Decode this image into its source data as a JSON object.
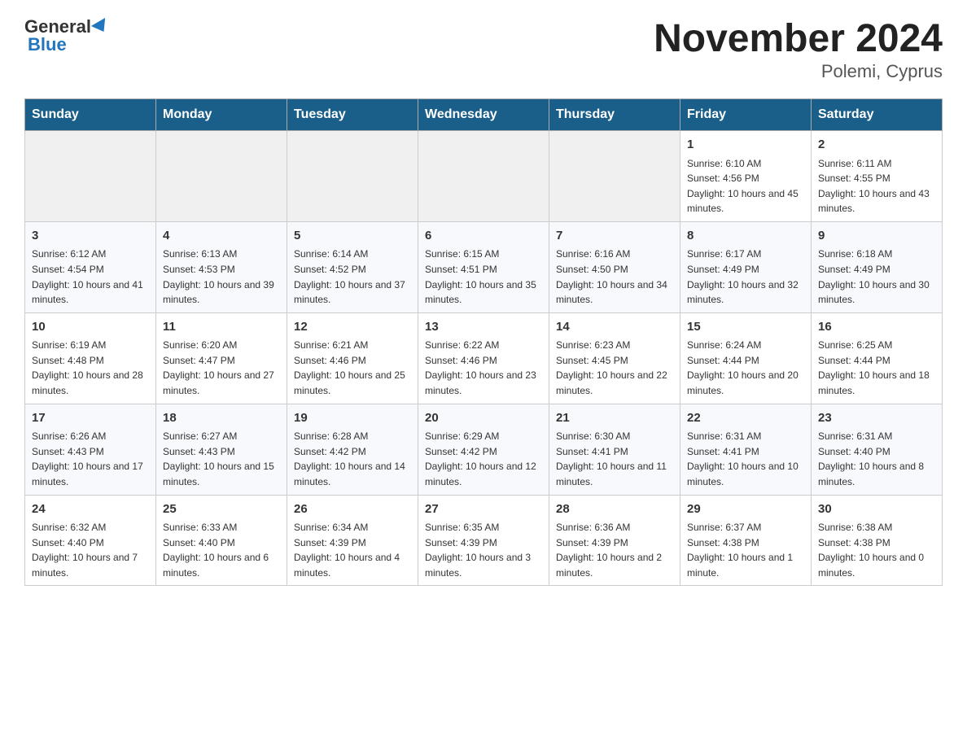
{
  "header": {
    "logo_general": "General",
    "logo_blue": "Blue",
    "title": "November 2024",
    "subtitle": "Polemi, Cyprus"
  },
  "weekdays": [
    "Sunday",
    "Monday",
    "Tuesday",
    "Wednesday",
    "Thursday",
    "Friday",
    "Saturday"
  ],
  "rows": [
    {
      "cells": [
        {
          "day": "",
          "info": ""
        },
        {
          "day": "",
          "info": ""
        },
        {
          "day": "",
          "info": ""
        },
        {
          "day": "",
          "info": ""
        },
        {
          "day": "",
          "info": ""
        },
        {
          "day": "1",
          "info": "Sunrise: 6:10 AM\nSunset: 4:56 PM\nDaylight: 10 hours and 45 minutes."
        },
        {
          "day": "2",
          "info": "Sunrise: 6:11 AM\nSunset: 4:55 PM\nDaylight: 10 hours and 43 minutes."
        }
      ]
    },
    {
      "cells": [
        {
          "day": "3",
          "info": "Sunrise: 6:12 AM\nSunset: 4:54 PM\nDaylight: 10 hours and 41 minutes."
        },
        {
          "day": "4",
          "info": "Sunrise: 6:13 AM\nSunset: 4:53 PM\nDaylight: 10 hours and 39 minutes."
        },
        {
          "day": "5",
          "info": "Sunrise: 6:14 AM\nSunset: 4:52 PM\nDaylight: 10 hours and 37 minutes."
        },
        {
          "day": "6",
          "info": "Sunrise: 6:15 AM\nSunset: 4:51 PM\nDaylight: 10 hours and 35 minutes."
        },
        {
          "day": "7",
          "info": "Sunrise: 6:16 AM\nSunset: 4:50 PM\nDaylight: 10 hours and 34 minutes."
        },
        {
          "day": "8",
          "info": "Sunrise: 6:17 AM\nSunset: 4:49 PM\nDaylight: 10 hours and 32 minutes."
        },
        {
          "day": "9",
          "info": "Sunrise: 6:18 AM\nSunset: 4:49 PM\nDaylight: 10 hours and 30 minutes."
        }
      ]
    },
    {
      "cells": [
        {
          "day": "10",
          "info": "Sunrise: 6:19 AM\nSunset: 4:48 PM\nDaylight: 10 hours and 28 minutes."
        },
        {
          "day": "11",
          "info": "Sunrise: 6:20 AM\nSunset: 4:47 PM\nDaylight: 10 hours and 27 minutes."
        },
        {
          "day": "12",
          "info": "Sunrise: 6:21 AM\nSunset: 4:46 PM\nDaylight: 10 hours and 25 minutes."
        },
        {
          "day": "13",
          "info": "Sunrise: 6:22 AM\nSunset: 4:46 PM\nDaylight: 10 hours and 23 minutes."
        },
        {
          "day": "14",
          "info": "Sunrise: 6:23 AM\nSunset: 4:45 PM\nDaylight: 10 hours and 22 minutes."
        },
        {
          "day": "15",
          "info": "Sunrise: 6:24 AM\nSunset: 4:44 PM\nDaylight: 10 hours and 20 minutes."
        },
        {
          "day": "16",
          "info": "Sunrise: 6:25 AM\nSunset: 4:44 PM\nDaylight: 10 hours and 18 minutes."
        }
      ]
    },
    {
      "cells": [
        {
          "day": "17",
          "info": "Sunrise: 6:26 AM\nSunset: 4:43 PM\nDaylight: 10 hours and 17 minutes."
        },
        {
          "day": "18",
          "info": "Sunrise: 6:27 AM\nSunset: 4:43 PM\nDaylight: 10 hours and 15 minutes."
        },
        {
          "day": "19",
          "info": "Sunrise: 6:28 AM\nSunset: 4:42 PM\nDaylight: 10 hours and 14 minutes."
        },
        {
          "day": "20",
          "info": "Sunrise: 6:29 AM\nSunset: 4:42 PM\nDaylight: 10 hours and 12 minutes."
        },
        {
          "day": "21",
          "info": "Sunrise: 6:30 AM\nSunset: 4:41 PM\nDaylight: 10 hours and 11 minutes."
        },
        {
          "day": "22",
          "info": "Sunrise: 6:31 AM\nSunset: 4:41 PM\nDaylight: 10 hours and 10 minutes."
        },
        {
          "day": "23",
          "info": "Sunrise: 6:31 AM\nSunset: 4:40 PM\nDaylight: 10 hours and 8 minutes."
        }
      ]
    },
    {
      "cells": [
        {
          "day": "24",
          "info": "Sunrise: 6:32 AM\nSunset: 4:40 PM\nDaylight: 10 hours and 7 minutes."
        },
        {
          "day": "25",
          "info": "Sunrise: 6:33 AM\nSunset: 4:40 PM\nDaylight: 10 hours and 6 minutes."
        },
        {
          "day": "26",
          "info": "Sunrise: 6:34 AM\nSunset: 4:39 PM\nDaylight: 10 hours and 4 minutes."
        },
        {
          "day": "27",
          "info": "Sunrise: 6:35 AM\nSunset: 4:39 PM\nDaylight: 10 hours and 3 minutes."
        },
        {
          "day": "28",
          "info": "Sunrise: 6:36 AM\nSunset: 4:39 PM\nDaylight: 10 hours and 2 minutes."
        },
        {
          "day": "29",
          "info": "Sunrise: 6:37 AM\nSunset: 4:38 PM\nDaylight: 10 hours and 1 minute."
        },
        {
          "day": "30",
          "info": "Sunrise: 6:38 AM\nSunset: 4:38 PM\nDaylight: 10 hours and 0 minutes."
        }
      ]
    }
  ]
}
